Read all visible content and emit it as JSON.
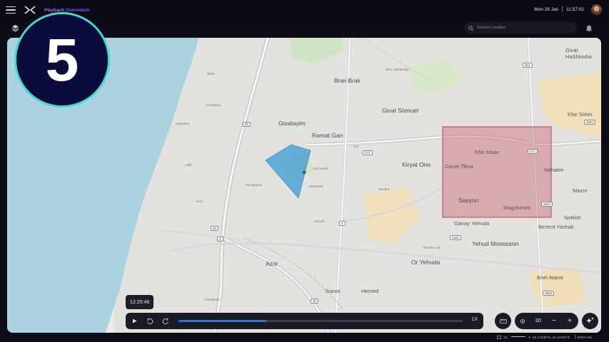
{
  "header": {
    "brand_part1": "Playback",
    "brand_part2": "Overwatch",
    "date": "Mon 29 Jan",
    "time": "11:57:02"
  },
  "search": {
    "placeholder": "Search Location"
  },
  "step_badge": "5",
  "map": {
    "places": [
      {
        "name": "Bnei Brak"
      },
      {
        "name": "Givat Shmuel"
      },
      {
        "name": "Givatayim"
      },
      {
        "name": "Ramat Gan"
      },
      {
        "name": "Kiryat Ono"
      },
      {
        "name": "Kfar Maas"
      },
      {
        "name": "Ganei Tikva"
      },
      {
        "name": "Savyon"
      },
      {
        "name": "Magshimim"
      },
      {
        "name": "Ganay Yehuda"
      },
      {
        "name": "Yehud Monosson"
      },
      {
        "name": "Or Yehuda"
      },
      {
        "name": "Azor"
      },
      {
        "name": "Ganot"
      },
      {
        "name": "Hemed"
      },
      {
        "name": "Nehalim"
      },
      {
        "name": "Mazor"
      },
      {
        "name": "Nofekh"
      },
      {
        "name": "Be'erot Yitzhak"
      },
      {
        "name": "Bnei Atarot"
      },
      {
        "name": "Kfar Sirkin"
      },
      {
        "name": "Givat HaShlosha"
      }
    ],
    "streets": [
      {
        "name": "Zeev Jabotinsky"
      },
      {
        "name": "Aluf Sadeh"
      },
      {
        "name": "Aluf David"
      },
      {
        "name": "Derekh Lod"
      },
      {
        "name": "Haroeh"
      },
      {
        "name": "Mendes"
      },
      {
        "name": "Ha'Hagana"
      },
      {
        "name": "Hayarkon"
      },
      {
        "name": "Jaffa"
      },
      {
        "name": "Herzl"
      },
      {
        "name": "Ha'Kibbutz"
      },
      {
        "name": "Hashalom"
      },
      {
        "name": "Fel"
      },
      {
        "name": "Bialik"
      }
    ],
    "route_shields": [
      "20",
      "20",
      "471",
      "471",
      "4",
      "4",
      "461",
      "40",
      "4622",
      "4623",
      "4613",
      "4602"
    ],
    "zone_color": "#c86070",
    "polygon_color": "#4ea3d2",
    "water_color": "#aad3df"
  },
  "timeline": {
    "current_time": "12:25:48",
    "progress": 0.31,
    "speed": "1X"
  },
  "view": {
    "mode": "3D",
    "minus": "−",
    "plus": "+"
  },
  "statusbar": {
    "scale": "1K",
    "coords": "32.12345°N, 34.12345°E",
    "altitude": "320M ASL"
  }
}
